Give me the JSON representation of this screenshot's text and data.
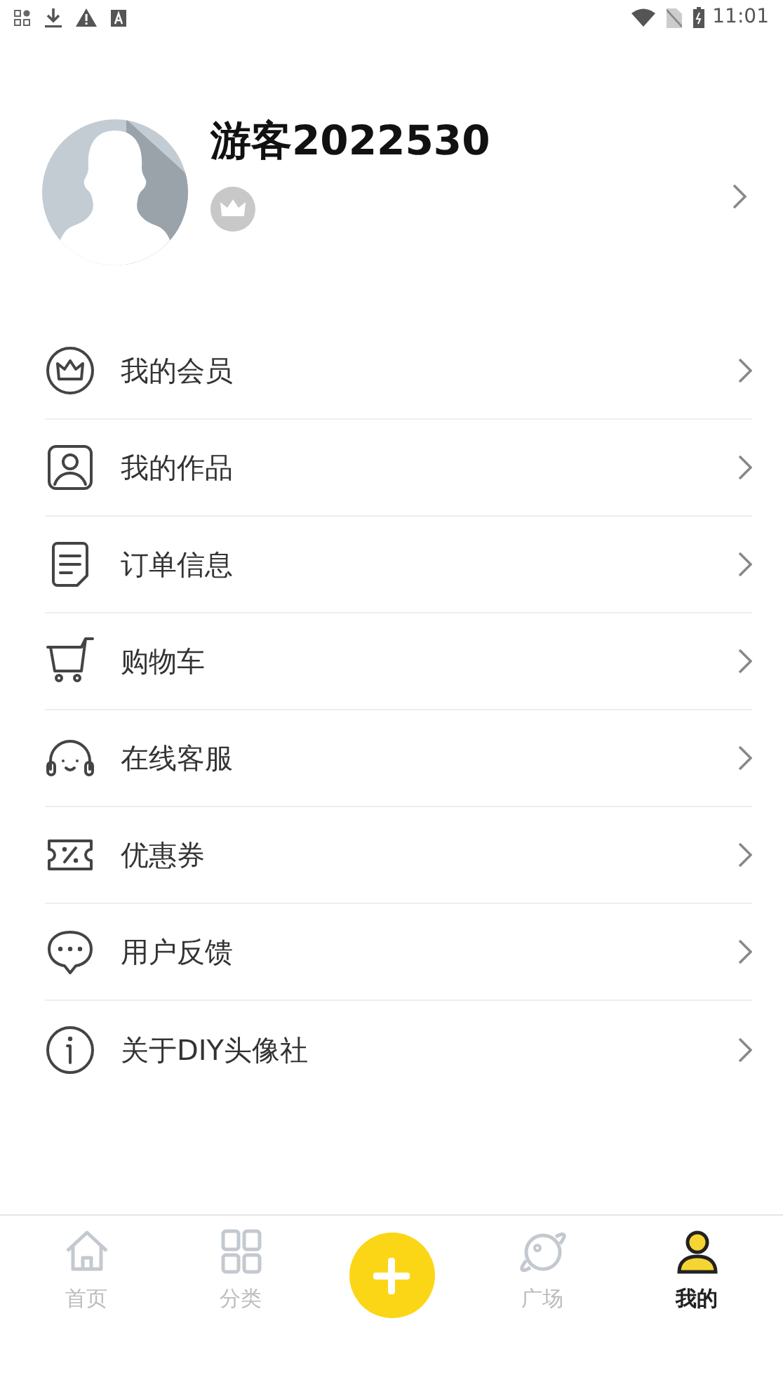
{
  "status_bar": {
    "time": "11:01"
  },
  "profile": {
    "username": "游客2022530"
  },
  "menu": [
    {
      "label": "我的会员"
    },
    {
      "label": "我的作品"
    },
    {
      "label": "订单信息"
    },
    {
      "label": "购物车"
    },
    {
      "label": "在线客服"
    },
    {
      "label": "优惠券"
    },
    {
      "label": "用户反馈"
    },
    {
      "label": "关于DIY头像社"
    }
  ],
  "tab_bar": [
    {
      "kind": "tab",
      "label": "首页",
      "selected": false
    },
    {
      "kind": "tab",
      "label": "分类",
      "selected": false
    },
    {
      "kind": "action"
    },
    {
      "kind": "tab",
      "label": "广场",
      "selected": false
    },
    {
      "kind": "tab",
      "label": "我的",
      "selected": true
    }
  ]
}
